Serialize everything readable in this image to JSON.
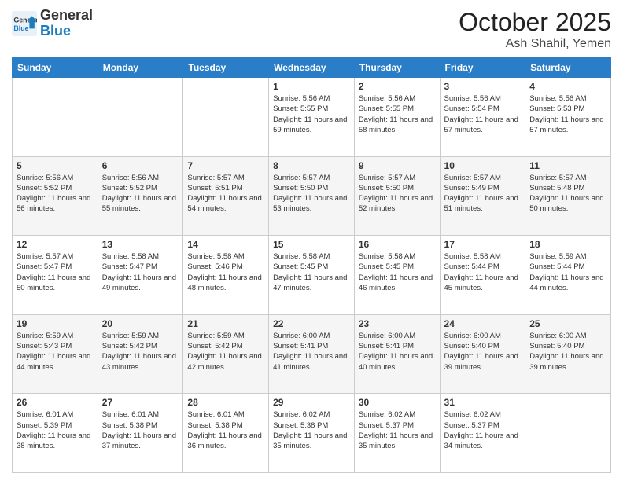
{
  "header": {
    "logo_line1": "General",
    "logo_line2": "Blue",
    "month": "October 2025",
    "location": "Ash Shahil, Yemen"
  },
  "days_of_week": [
    "Sunday",
    "Monday",
    "Tuesday",
    "Wednesday",
    "Thursday",
    "Friday",
    "Saturday"
  ],
  "weeks": [
    [
      {
        "day": "",
        "sunrise": "",
        "sunset": "",
        "daylight": ""
      },
      {
        "day": "",
        "sunrise": "",
        "sunset": "",
        "daylight": ""
      },
      {
        "day": "",
        "sunrise": "",
        "sunset": "",
        "daylight": ""
      },
      {
        "day": "1",
        "sunrise": "Sunrise: 5:56 AM",
        "sunset": "Sunset: 5:55 PM",
        "daylight": "Daylight: 11 hours and 59 minutes."
      },
      {
        "day": "2",
        "sunrise": "Sunrise: 5:56 AM",
        "sunset": "Sunset: 5:55 PM",
        "daylight": "Daylight: 11 hours and 58 minutes."
      },
      {
        "day": "3",
        "sunrise": "Sunrise: 5:56 AM",
        "sunset": "Sunset: 5:54 PM",
        "daylight": "Daylight: 11 hours and 57 minutes."
      },
      {
        "day": "4",
        "sunrise": "Sunrise: 5:56 AM",
        "sunset": "Sunset: 5:53 PM",
        "daylight": "Daylight: 11 hours and 57 minutes."
      }
    ],
    [
      {
        "day": "5",
        "sunrise": "Sunrise: 5:56 AM",
        "sunset": "Sunset: 5:52 PM",
        "daylight": "Daylight: 11 hours and 56 minutes."
      },
      {
        "day": "6",
        "sunrise": "Sunrise: 5:56 AM",
        "sunset": "Sunset: 5:52 PM",
        "daylight": "Daylight: 11 hours and 55 minutes."
      },
      {
        "day": "7",
        "sunrise": "Sunrise: 5:57 AM",
        "sunset": "Sunset: 5:51 PM",
        "daylight": "Daylight: 11 hours and 54 minutes."
      },
      {
        "day": "8",
        "sunrise": "Sunrise: 5:57 AM",
        "sunset": "Sunset: 5:50 PM",
        "daylight": "Daylight: 11 hours and 53 minutes."
      },
      {
        "day": "9",
        "sunrise": "Sunrise: 5:57 AM",
        "sunset": "Sunset: 5:50 PM",
        "daylight": "Daylight: 11 hours and 52 minutes."
      },
      {
        "day": "10",
        "sunrise": "Sunrise: 5:57 AM",
        "sunset": "Sunset: 5:49 PM",
        "daylight": "Daylight: 11 hours and 51 minutes."
      },
      {
        "day": "11",
        "sunrise": "Sunrise: 5:57 AM",
        "sunset": "Sunset: 5:48 PM",
        "daylight": "Daylight: 11 hours and 50 minutes."
      }
    ],
    [
      {
        "day": "12",
        "sunrise": "Sunrise: 5:57 AM",
        "sunset": "Sunset: 5:47 PM",
        "daylight": "Daylight: 11 hours and 50 minutes."
      },
      {
        "day": "13",
        "sunrise": "Sunrise: 5:58 AM",
        "sunset": "Sunset: 5:47 PM",
        "daylight": "Daylight: 11 hours and 49 minutes."
      },
      {
        "day": "14",
        "sunrise": "Sunrise: 5:58 AM",
        "sunset": "Sunset: 5:46 PM",
        "daylight": "Daylight: 11 hours and 48 minutes."
      },
      {
        "day": "15",
        "sunrise": "Sunrise: 5:58 AM",
        "sunset": "Sunset: 5:45 PM",
        "daylight": "Daylight: 11 hours and 47 minutes."
      },
      {
        "day": "16",
        "sunrise": "Sunrise: 5:58 AM",
        "sunset": "Sunset: 5:45 PM",
        "daylight": "Daylight: 11 hours and 46 minutes."
      },
      {
        "day": "17",
        "sunrise": "Sunrise: 5:58 AM",
        "sunset": "Sunset: 5:44 PM",
        "daylight": "Daylight: 11 hours and 45 minutes."
      },
      {
        "day": "18",
        "sunrise": "Sunrise: 5:59 AM",
        "sunset": "Sunset: 5:44 PM",
        "daylight": "Daylight: 11 hours and 44 minutes."
      }
    ],
    [
      {
        "day": "19",
        "sunrise": "Sunrise: 5:59 AM",
        "sunset": "Sunset: 5:43 PM",
        "daylight": "Daylight: 11 hours and 44 minutes."
      },
      {
        "day": "20",
        "sunrise": "Sunrise: 5:59 AM",
        "sunset": "Sunset: 5:42 PM",
        "daylight": "Daylight: 11 hours and 43 minutes."
      },
      {
        "day": "21",
        "sunrise": "Sunrise: 5:59 AM",
        "sunset": "Sunset: 5:42 PM",
        "daylight": "Daylight: 11 hours and 42 minutes."
      },
      {
        "day": "22",
        "sunrise": "Sunrise: 6:00 AM",
        "sunset": "Sunset: 5:41 PM",
        "daylight": "Daylight: 11 hours and 41 minutes."
      },
      {
        "day": "23",
        "sunrise": "Sunrise: 6:00 AM",
        "sunset": "Sunset: 5:41 PM",
        "daylight": "Daylight: 11 hours and 40 minutes."
      },
      {
        "day": "24",
        "sunrise": "Sunrise: 6:00 AM",
        "sunset": "Sunset: 5:40 PM",
        "daylight": "Daylight: 11 hours and 39 minutes."
      },
      {
        "day": "25",
        "sunrise": "Sunrise: 6:00 AM",
        "sunset": "Sunset: 5:40 PM",
        "daylight": "Daylight: 11 hours and 39 minutes."
      }
    ],
    [
      {
        "day": "26",
        "sunrise": "Sunrise: 6:01 AM",
        "sunset": "Sunset: 5:39 PM",
        "daylight": "Daylight: 11 hours and 38 minutes."
      },
      {
        "day": "27",
        "sunrise": "Sunrise: 6:01 AM",
        "sunset": "Sunset: 5:38 PM",
        "daylight": "Daylight: 11 hours and 37 minutes."
      },
      {
        "day": "28",
        "sunrise": "Sunrise: 6:01 AM",
        "sunset": "Sunset: 5:38 PM",
        "daylight": "Daylight: 11 hours and 36 minutes."
      },
      {
        "day": "29",
        "sunrise": "Sunrise: 6:02 AM",
        "sunset": "Sunset: 5:38 PM",
        "daylight": "Daylight: 11 hours and 35 minutes."
      },
      {
        "day": "30",
        "sunrise": "Sunrise: 6:02 AM",
        "sunset": "Sunset: 5:37 PM",
        "daylight": "Daylight: 11 hours and 35 minutes."
      },
      {
        "day": "31",
        "sunrise": "Sunrise: 6:02 AM",
        "sunset": "Sunset: 5:37 PM",
        "daylight": "Daylight: 11 hours and 34 minutes."
      },
      {
        "day": "",
        "sunrise": "",
        "sunset": "",
        "daylight": ""
      }
    ]
  ]
}
